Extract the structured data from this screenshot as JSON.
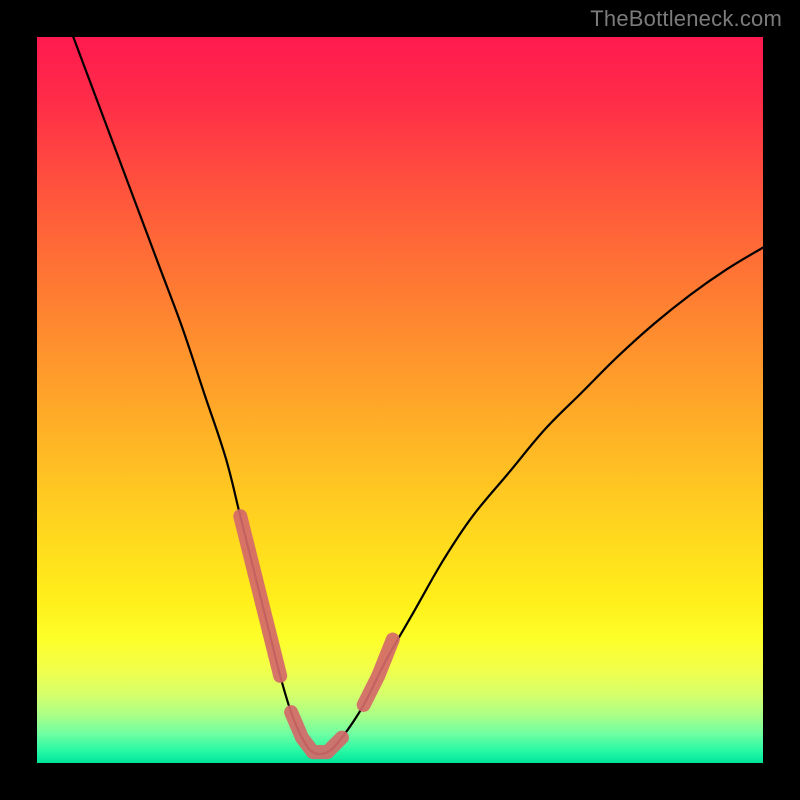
{
  "attribution": "TheBottleneck.com",
  "gradient_stops": [
    {
      "offset": 0.0,
      "color": "#ff1a4f"
    },
    {
      "offset": 0.08,
      "color": "#ff2a49"
    },
    {
      "offset": 0.18,
      "color": "#ff4a3f"
    },
    {
      "offset": 0.3,
      "color": "#ff6d36"
    },
    {
      "offset": 0.42,
      "color": "#ff8f2e"
    },
    {
      "offset": 0.55,
      "color": "#ffb326"
    },
    {
      "offset": 0.67,
      "color": "#ffd41f"
    },
    {
      "offset": 0.78,
      "color": "#fff01a"
    },
    {
      "offset": 0.83,
      "color": "#fdff2a"
    },
    {
      "offset": 0.87,
      "color": "#f2ff4a"
    },
    {
      "offset": 0.905,
      "color": "#d6ff6a"
    },
    {
      "offset": 0.935,
      "color": "#a8ff88"
    },
    {
      "offset": 0.96,
      "color": "#6effa2"
    },
    {
      "offset": 0.985,
      "color": "#23f7a4"
    },
    {
      "offset": 1.0,
      "color": "#00e39b"
    }
  ],
  "chart_data": {
    "type": "line",
    "title": "",
    "xlabel": "",
    "ylabel": "",
    "xlim": [
      0,
      100
    ],
    "ylim": [
      0,
      100
    ],
    "grid": false,
    "series": [
      {
        "name": "bottleneck-curve",
        "x": [
          5,
          8,
          11,
          14,
          17,
          20,
          23,
          26,
          28,
          30,
          32,
          33.5,
          35,
          36.5,
          38,
          40,
          42,
          45,
          48,
          52,
          56,
          60,
          65,
          70,
          75,
          80,
          85,
          90,
          95,
          100
        ],
        "y": [
          100,
          92,
          84,
          76,
          68,
          60,
          51,
          42,
          34,
          26,
          18,
          12,
          7,
          3.5,
          1.5,
          1.5,
          3.5,
          8,
          14,
          21,
          28,
          34,
          40,
          46,
          51,
          56,
          60.5,
          64.5,
          68,
          71
        ]
      },
      {
        "name": "highlight-segments",
        "segments": [
          {
            "x": [
              28,
              30,
              32,
              33.5
            ],
            "y": [
              34,
              26,
              18,
              12
            ]
          },
          {
            "x": [
              35,
              36.5,
              38,
              40,
              42
            ],
            "y": [
              7,
              3.5,
              1.5,
              1.5,
              3.5
            ]
          },
          {
            "x": [
              45,
              47,
              49
            ],
            "y": [
              8,
              12,
              17
            ]
          }
        ]
      }
    ]
  }
}
